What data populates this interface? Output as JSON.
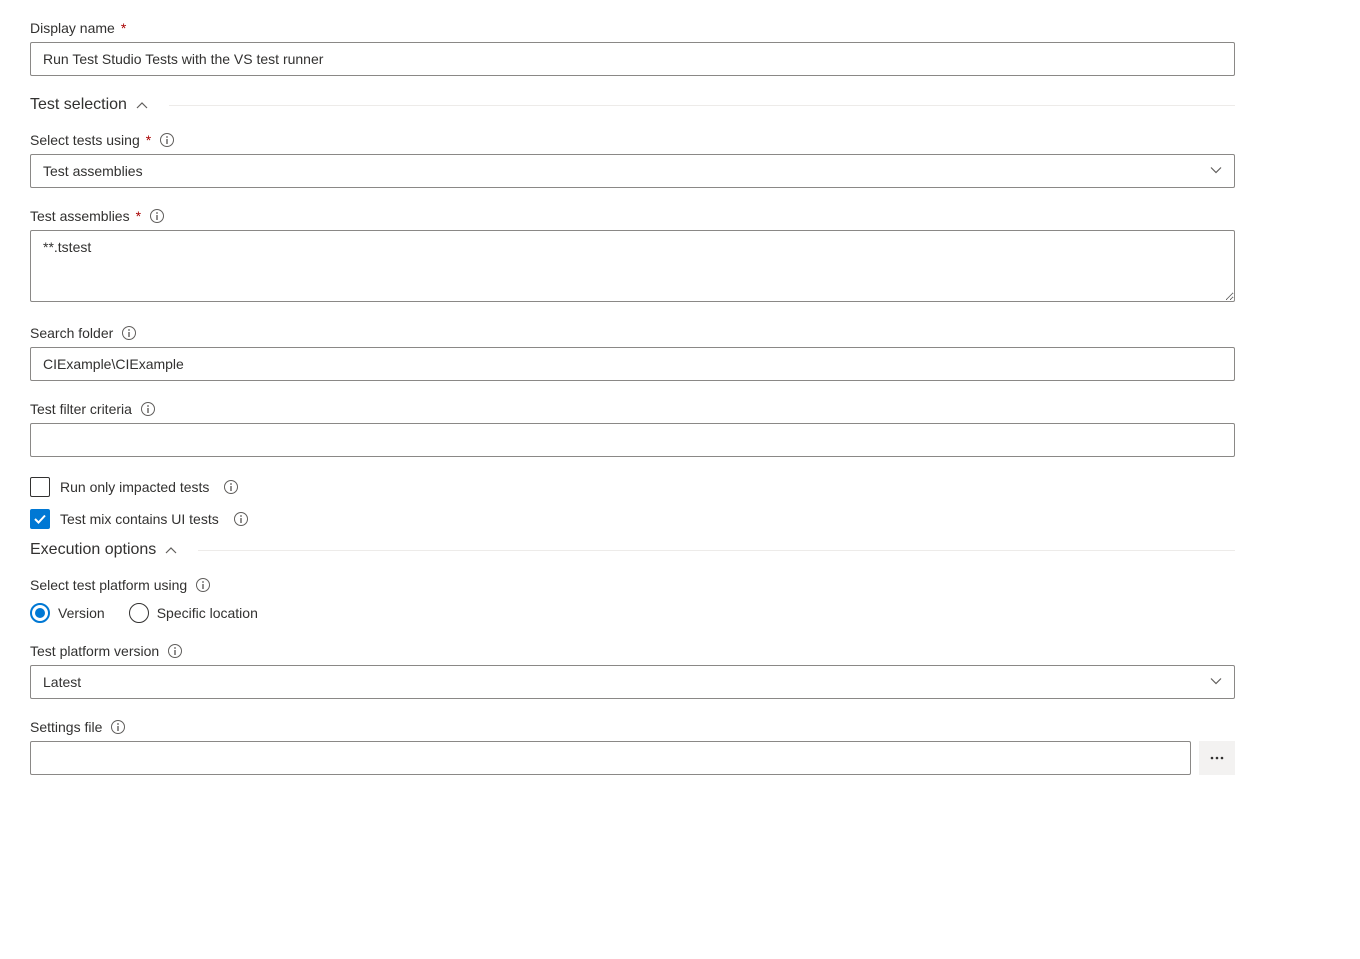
{
  "displayName": {
    "label": "Display name",
    "value": "Run Test Studio Tests with the VS test runner"
  },
  "sections": {
    "testSelection": {
      "title": "Test selection",
      "selectTestsUsing": {
        "label": "Select tests using",
        "value": "Test assemblies"
      },
      "testAssemblies": {
        "label": "Test assemblies",
        "value": "**.tstest"
      },
      "searchFolder": {
        "label": "Search folder",
        "value": "CIExample\\CIExample"
      },
      "testFilterCriteria": {
        "label": "Test filter criteria",
        "value": ""
      },
      "runOnlyImpacted": {
        "label": "Run only impacted tests",
        "checked": false
      },
      "testMixUI": {
        "label": "Test mix contains UI tests",
        "checked": true
      }
    },
    "executionOptions": {
      "title": "Execution options",
      "selectTestPlatformUsing": {
        "label": "Select test platform using",
        "options": {
          "version": "Version",
          "specificLocation": "Specific location"
        },
        "selected": "version"
      },
      "testPlatformVersion": {
        "label": "Test platform version",
        "value": "Latest"
      },
      "settingsFile": {
        "label": "Settings file",
        "value": ""
      }
    }
  }
}
